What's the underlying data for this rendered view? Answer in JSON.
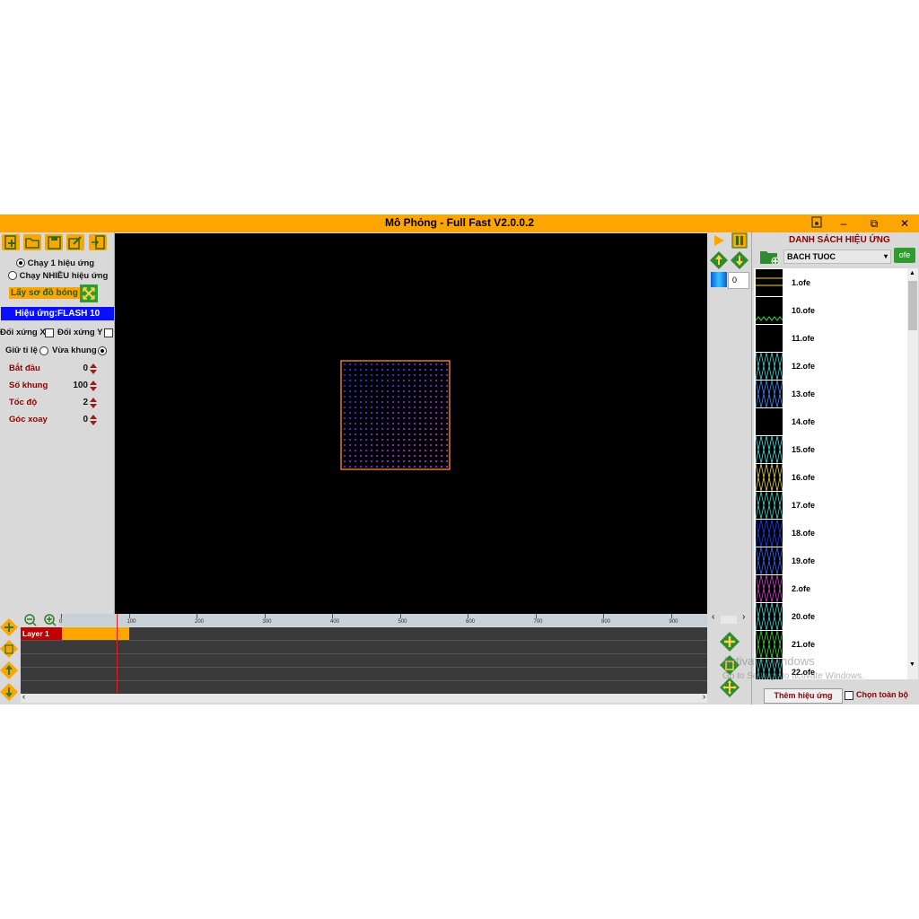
{
  "window": {
    "title": "Mô Phỏng -  Full Fast V2.0.0.2"
  },
  "controls": {
    "run_one_label": "Chạy 1 hiệu ứng",
    "run_many_label": "Chạy NHIỀU hiệu ứng",
    "shadow_label": "Lấy sơ đồ bóng",
    "effect_title": "Hiệu ứng:FLASH 10",
    "mirror_x_label": "Đối xứng X",
    "mirror_y_label": "Đối xứng Y",
    "keep_ratio_label": "Giữ tỉ lệ",
    "fit_frame_label": "Vừa khung",
    "params": [
      {
        "label": "Bắt đầu",
        "value": "0"
      },
      {
        "label": "Số khung",
        "value": "100"
      },
      {
        "label": "Tốc độ",
        "value": "2"
      },
      {
        "label": "Góc xoay",
        "value": "0"
      }
    ]
  },
  "side": {
    "color_value": "0"
  },
  "effects_panel": {
    "title": "DANH SÁCH HIỆU ỨNG",
    "folder_value": "BACH TUOC",
    "ofe_label": "ofe",
    "items": [
      "1.ofe",
      "10.ofe",
      "11.ofe",
      "12.ofe",
      "13.ofe",
      "14.ofe",
      "15.ofe",
      "16.ofe",
      "17.ofe",
      "18.ofe",
      "19.ofe",
      "2.ofe",
      "20.ofe",
      "21.ofe",
      "22.ofe"
    ],
    "add_button": "Thêm hiệu ứng",
    "select_all_label": "Chọn toàn bộ"
  },
  "timeline": {
    "layer_label": "Layer 1",
    "ruler_ticks": [
      "0",
      "100",
      "200",
      "300",
      "400",
      "500",
      "600",
      "700",
      "800",
      "900"
    ]
  },
  "watermark": {
    "line1": "Activate Windows",
    "line2": "Go to Settings to activate Windows."
  }
}
